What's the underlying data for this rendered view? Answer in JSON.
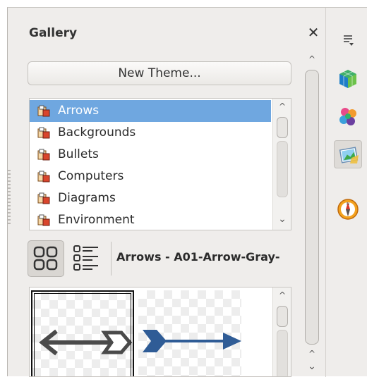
{
  "panel": {
    "title": "Gallery",
    "close_icon": "close-icon",
    "new_theme_label": "New Theme..."
  },
  "themes": {
    "items": [
      {
        "label": "Arrows",
        "selected": true
      },
      {
        "label": "Backgrounds",
        "selected": false
      },
      {
        "label": "Bullets",
        "selected": false
      },
      {
        "label": "Computers",
        "selected": false
      },
      {
        "label": "Diagrams",
        "selected": false
      },
      {
        "label": "Environment",
        "selected": false
      }
    ],
    "item_icon": "theme-folder-icon"
  },
  "view": {
    "icon_view_icon": "icon-view-icon",
    "detail_view_icon": "detail-view-icon",
    "current_item_label": "Arrows - A01-Arrow-Gray-"
  },
  "preview": {
    "items": [
      {
        "icon": "gray-left-arrow-icon",
        "selected": true
      },
      {
        "icon": "blue-right-arrow-icon",
        "selected": false
      }
    ]
  },
  "deck": {
    "menu_icon": "sidebar-menu-icon",
    "buttons": [
      {
        "icon": "properties-icon",
        "active": false
      },
      {
        "icon": "styles-icon",
        "active": false
      },
      {
        "icon": "gallery-icon",
        "active": true
      },
      {
        "icon": "navigator-icon",
        "active": false
      }
    ]
  },
  "colors": {
    "selection": "#6fa7e0",
    "panel_bg": "#efedeb",
    "arrow_gray": "#4a4a4a",
    "arrow_blue": "#2f5c96"
  }
}
